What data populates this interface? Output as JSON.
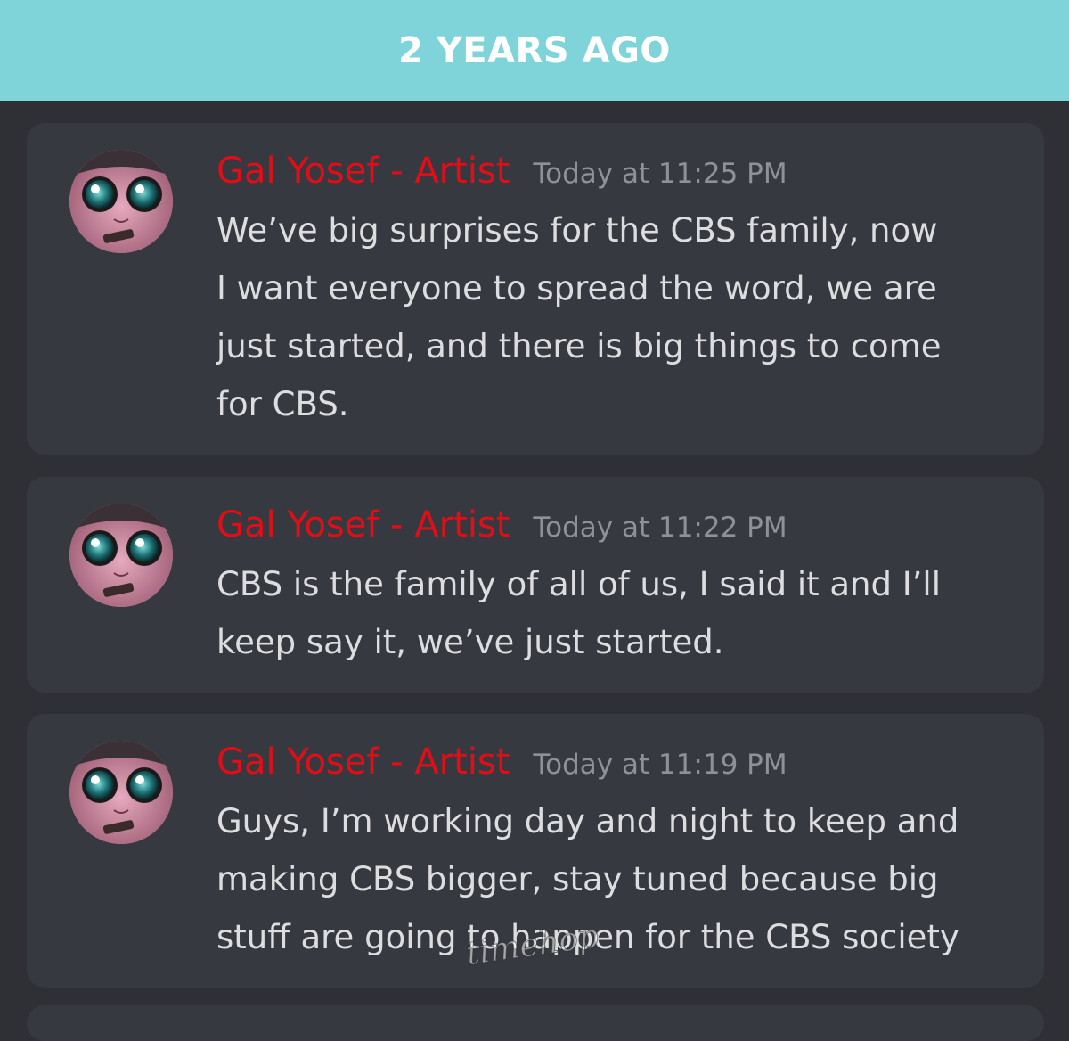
{
  "header": {
    "title": "2 YEARS AGO",
    "background_color": "#7fd4d9"
  },
  "colors": {
    "author": "#e10e17",
    "timestamp": "#8e9297",
    "body_text": "#dcddde",
    "card_background": "#36393f",
    "page_background": "#2e3035"
  },
  "messages": [
    {
      "author": "Gal Yosef - Artist",
      "timestamp": "Today at 11:25 PM",
      "avatar_icon": "pink-creature-avatar",
      "lines": [
        "We’ve big surprises for the CBS family, now",
        "I want everyone to spread the word, we are",
        "just started,  and there is big things to come",
        "for CBS."
      ]
    },
    {
      "author": "Gal Yosef - Artist",
      "timestamp": "Today at 11:22 PM",
      "avatar_icon": "pink-creature-avatar",
      "lines": [
        "CBS is the family of all of us, I said it and I’ll",
        "keep say it, we’ve just started."
      ]
    },
    {
      "author": "Gal Yosef - Artist",
      "timestamp": "Today at 11:19 PM",
      "avatar_icon": "pink-creature-avatar",
      "lines": [
        "Guys, I’m working day and night to keep and",
        "making CBS bigger, stay tuned because big",
        "stuff are going to happen for the CBS society"
      ]
    }
  ],
  "watermark": {
    "text": "timehop"
  }
}
